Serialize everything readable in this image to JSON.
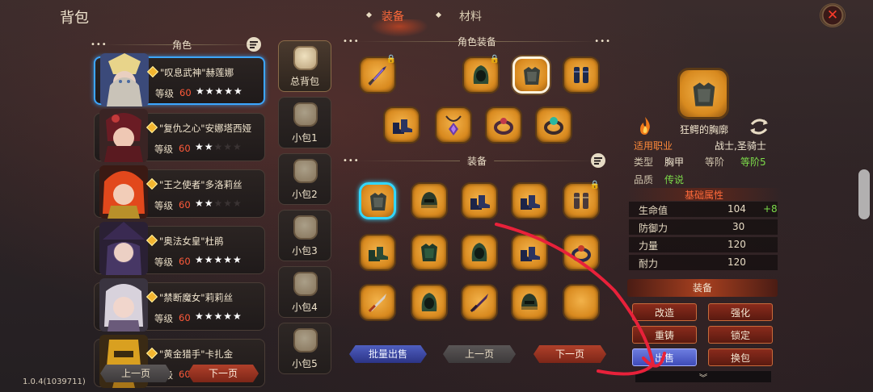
{
  "header": {
    "title": "背包",
    "tabs": [
      {
        "label": "装备",
        "active": true
      },
      {
        "label": "材料",
        "active": false
      }
    ],
    "accent_color": "#ff6a3a"
  },
  "characters": {
    "header": "角色",
    "level_label": "等级",
    "items": [
      {
        "name": "\"叹息武神\"赫莲娜",
        "level": "60",
        "stars": 5,
        "selected": true
      },
      {
        "name": "\"复仇之心\"安娜塔西娅",
        "level": "60",
        "stars": 2,
        "selected": false
      },
      {
        "name": "\"王之使者\"多洛莉丝",
        "level": "60",
        "stars": 2,
        "selected": false
      },
      {
        "name": "\"奥法女皇\"杜鹃",
        "level": "60",
        "stars": 5,
        "selected": false
      },
      {
        "name": "\"禁断魔女\"莉莉丝",
        "level": "60",
        "stars": 5,
        "selected": false
      },
      {
        "name": "\"黄金猎手\"卡扎金",
        "level": "60",
        "stars": 0,
        "selected": false
      }
    ],
    "prev_label": "上一页",
    "next_label": "下一页"
  },
  "bags": [
    {
      "label": "总背包",
      "active": true
    },
    {
      "label": "小包1",
      "active": false
    },
    {
      "label": "小包2",
      "active": false
    },
    {
      "label": "小包3",
      "active": false
    },
    {
      "label": "小包4",
      "active": false
    },
    {
      "label": "小包5",
      "active": false
    }
  ],
  "character_equipment": {
    "header": "角色装备",
    "slots": [
      "sword-icon",
      "hood-icon",
      "chest-armor-icon",
      "bracers-icon",
      "boots-icon",
      "amulet-icon",
      "ring-icon",
      "gem-ring-icon"
    ]
  },
  "equipment": {
    "header": "装备",
    "items": [
      "chest-armor-icon",
      "helmet-icon",
      "boots-icon",
      "boots-icon",
      "bracers-icon",
      "boots-icon",
      "chest-armor-icon",
      "hood-icon",
      "boots-icon",
      "ring-icon",
      "dagger-icon",
      "hood-icon",
      "dagger-icon",
      "helmet-icon",
      "empty-slot"
    ],
    "batch_sell_label": "批量出售",
    "prev_label": "上一页",
    "next_label": "下一页"
  },
  "detail": {
    "name": "狂鳄的胸廓",
    "class_label": "适用职业",
    "class_value": "战士,圣骑士",
    "type_label": "类型",
    "type_value": "胸甲",
    "tier_label": "等阶",
    "tier_value": "等阶5",
    "quality_label": "品质",
    "quality_value": "传说",
    "basic_attrs_header": "基础属性",
    "stats": [
      {
        "name": "生命值",
        "value": "104",
        "bonus": "+8"
      },
      {
        "name": "防御力",
        "value": "30",
        "bonus": ""
      },
      {
        "name": "力量",
        "value": "120",
        "bonus": ""
      },
      {
        "name": "耐力",
        "value": "120",
        "bonus": ""
      }
    ],
    "equip_label": "装备",
    "actions": [
      "改造",
      "强化",
      "重铸",
      "锁定",
      "出售",
      "换包"
    ]
  },
  "footer": {
    "version": "1.0.4(1039711)"
  }
}
